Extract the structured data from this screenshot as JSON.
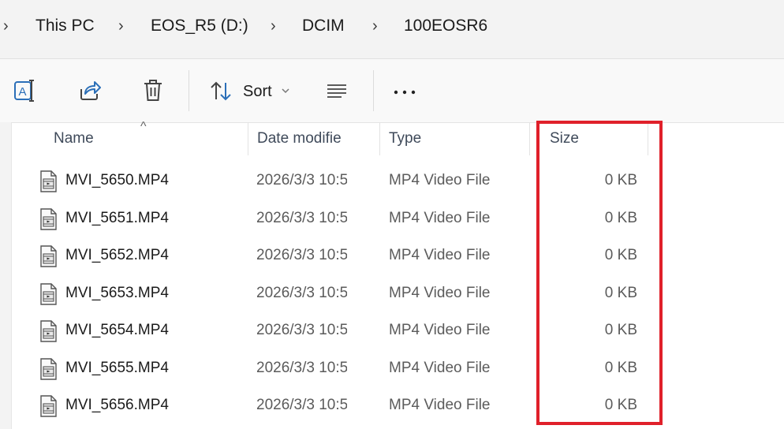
{
  "address_bar": {
    "segments": [
      "This PC",
      "EOS_R5 (D:)",
      "DCIM",
      "100EOSR6"
    ]
  },
  "toolbar": {
    "sort_label": "Sort",
    "icons": [
      "rename-icon",
      "share-icon",
      "delete-icon",
      "sort-icon",
      "view-icon",
      "more-icon"
    ]
  },
  "columns": {
    "name": "Name",
    "date": "Date modifie",
    "type": "Type",
    "size": "Size"
  },
  "files": [
    {
      "name": "MVI_5650.MP4",
      "date": "2026/3/3 10:5",
      "type": "MP4 Video File",
      "size": "0 KB"
    },
    {
      "name": "MVI_5651.MP4",
      "date": "2026/3/3 10:5",
      "type": "MP4 Video File",
      "size": "0 KB"
    },
    {
      "name": "MVI_5652.MP4",
      "date": "2026/3/3 10:5",
      "type": "MP4 Video File",
      "size": "0 KB"
    },
    {
      "name": "MVI_5653.MP4",
      "date": "2026/3/3 10:5",
      "type": "MP4 Video File",
      "size": "0 KB"
    },
    {
      "name": "MVI_5654.MP4",
      "date": "2026/3/3 10:5",
      "type": "MP4 Video File",
      "size": "0 KB"
    },
    {
      "name": "MVI_5655.MP4",
      "date": "2026/3/3 10:5",
      "type": "MP4 Video File",
      "size": "0 KB"
    },
    {
      "name": "MVI_5656.MP4",
      "date": "2026/3/3 10:5",
      "type": "MP4 Video File",
      "size": "0 KB"
    }
  ],
  "colors": {
    "highlight_border": "#e0202a",
    "accent_icon": "#2b6fb8"
  }
}
